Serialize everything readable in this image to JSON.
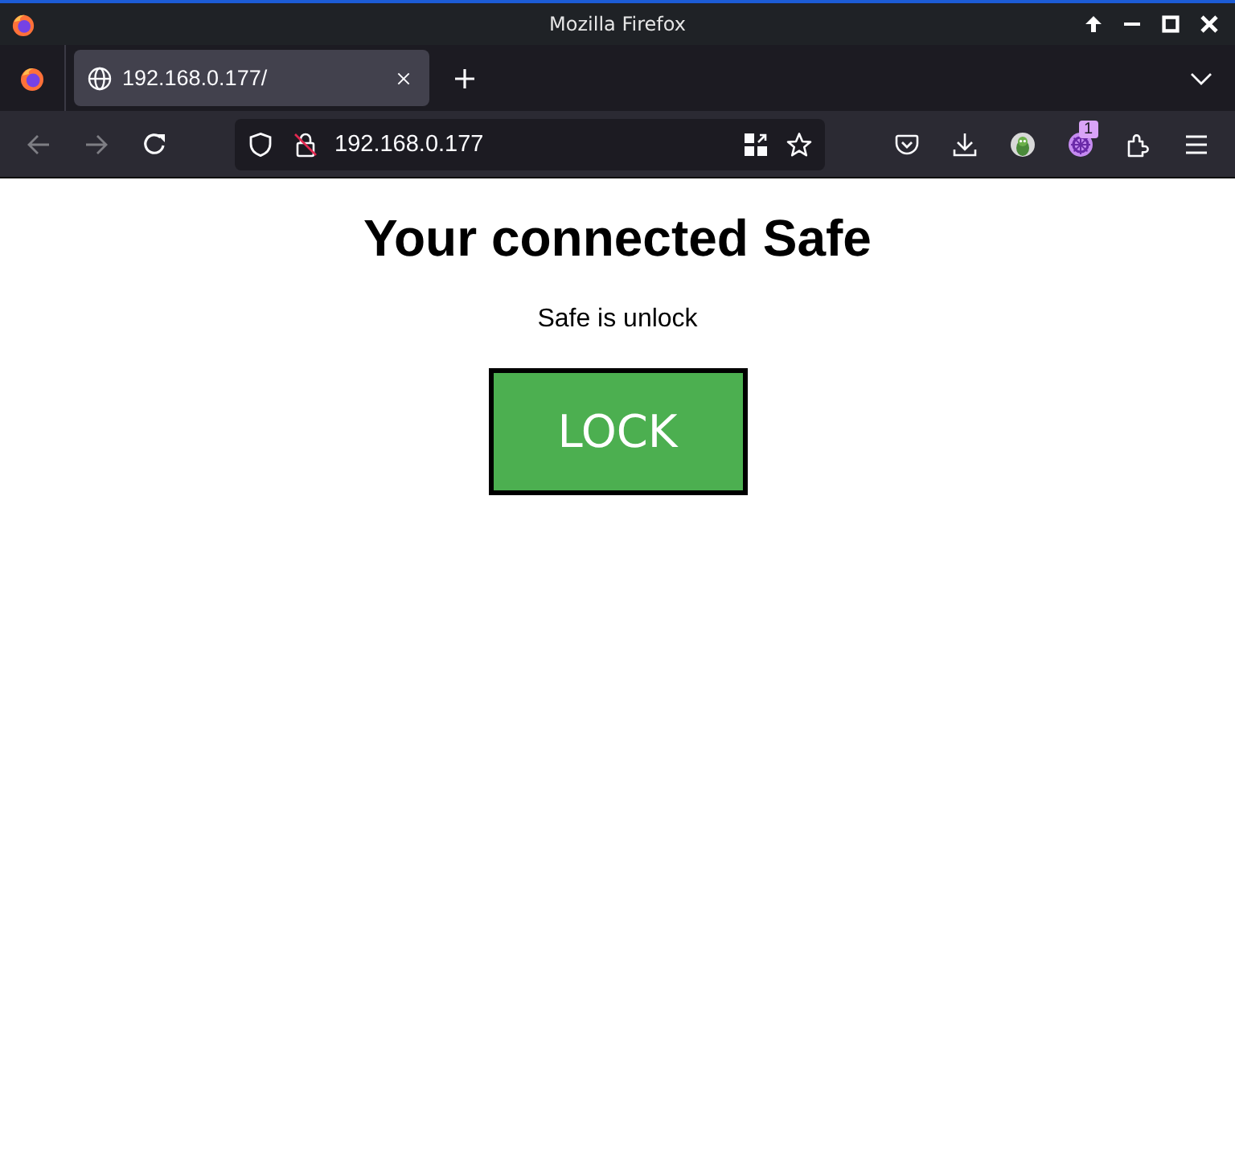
{
  "window": {
    "title": "Mozilla Firefox"
  },
  "tabs": [
    {
      "label": "192.168.0.177/",
      "selected": true
    }
  ],
  "navigation": {
    "back_disabled": true,
    "forward_disabled": true
  },
  "address_bar": {
    "value": "192.168.0.177"
  },
  "toolbar": {
    "extension_badge": "1"
  },
  "page": {
    "heading": "Your connected Safe",
    "status": "Safe is unlock",
    "button": "LOCK"
  }
}
